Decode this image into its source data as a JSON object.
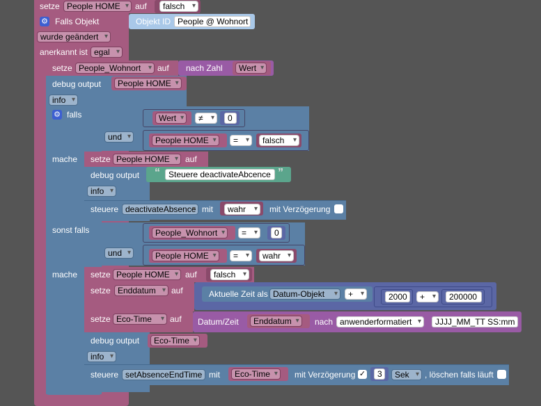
{
  "top": {
    "setze_label": "setze",
    "var_people_home": "People HOME",
    "auf_label": "auf",
    "value_falsch": "falsch"
  },
  "trigger": {
    "falls_objekt": "Falls Objekt",
    "objekt_id_label": "Objekt ID",
    "objekt_id_value": "People @ Wohnort",
    "wurde_geaendert": "wurde geändert",
    "anerkannt_ist": "anerkannt ist",
    "egal": "egal"
  },
  "b1": {
    "setze_label": "setze",
    "var": "People_Wohnort",
    "auf_label": "auf",
    "nach_zahl": "nach Zahl",
    "wert": "Wert"
  },
  "b2": {
    "debug_output": "debug output",
    "var": "People HOME",
    "level": "info"
  },
  "if1": {
    "falls": "falls",
    "und": "und",
    "cond1_var": "Wert",
    "cond1_op": "≠",
    "cond1_num": "0",
    "cond2_var": "People HOME",
    "cond2_op": "=",
    "cond2_val": "falsch",
    "mache": "mache",
    "set_label": "setze",
    "set_var": "People HOME",
    "set_auf": "auf",
    "debug_output": "debug output",
    "debug_text": "Steuere deactivateAbcence",
    "debug_level": "info",
    "steuere": "steuere",
    "steuere_target": "deactivateAbsence",
    "mit": "mit",
    "steuere_value": "wahr",
    "mit_verzoegerung": "mit Verzögerung"
  },
  "elif": {
    "sonst_falls": "sonst falls",
    "und": "und",
    "cond1_var": "People_Wohnort",
    "cond1_op": "=",
    "cond1_num": "0",
    "cond2_var": "People HOME",
    "cond2_op": "=",
    "cond2_val": "wahr",
    "mache": "mache",
    "set1_label": "setze",
    "set1_var": "People HOME",
    "set1_auf": "auf",
    "set1_val": "falsch",
    "set2_label": "setze",
    "set2_var": "Enddatum",
    "set2_auf": "auf",
    "aktuelle_zeit": "Aktuelle Zeit als",
    "datum_objekt": "Datum-Objekt",
    "plus": "+",
    "num1": "2000",
    "plus2": "+",
    "num2": "200000",
    "set3_label": "setze",
    "set3_var": "Eco-Time",
    "set3_auf": "auf",
    "datum_zeit": "Datum/Zeit",
    "enddatum": "Enddatum",
    "nach": "nach",
    "format_mode": "anwenderformatiert",
    "format_str": "JJJJ_MM_TT SS:mm",
    "debug_output": "debug output",
    "debug_var": "Eco-Time",
    "debug_level": "info",
    "steuere": "steuere",
    "steuere_target": "setAbsenceEndTime",
    "mit": "mit",
    "steuere_var": "Eco-Time",
    "mit_verzoegerung": "mit Verzögerung",
    "checkmark": "✓",
    "delay_num": "3",
    "delay_unit": "Sek",
    "loeschen": ", löschen falls läuft"
  },
  "colors": {
    "background": "#555555",
    "pink": "#a55b80",
    "blue": "#5b80a5",
    "purple": "#a55b99",
    "gear": "#3d5fd1"
  },
  "icons": {
    "gear": "gear-icon",
    "quote_open": "“",
    "quote_close": "”"
  }
}
